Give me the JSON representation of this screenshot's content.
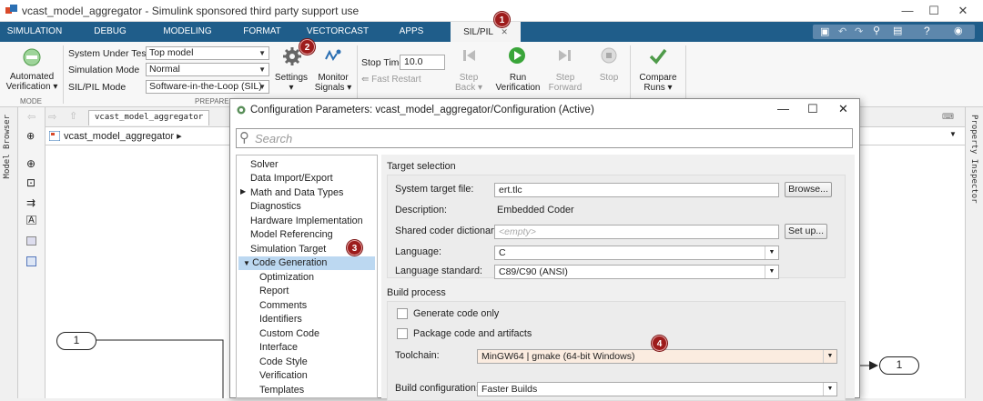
{
  "window": {
    "title": "vcast_model_aggregator - Simulink sponsored third party support use"
  },
  "tabs": [
    "SIMULATION",
    "DEBUG",
    "MODELING",
    "FORMAT",
    "VECTORCAST",
    "APPS",
    "SIL/PIL"
  ],
  "ribbon": {
    "auto_verif": "Automated\nVerification ▾",
    "system_under_test_label": "System Under Test",
    "system_under_test_value": "Top model",
    "sim_mode_label": "Simulation Mode",
    "sim_mode_value": "Normal",
    "silpil_mode_label": "SIL/PIL Mode",
    "silpil_mode_value": "Software-in-the-Loop (SIL)",
    "settings": "Settings",
    "monitor": "Monitor",
    "signals": "Signals ▾",
    "stop_time_label": "Stop Time",
    "stop_time_value": "10.0",
    "fast_restart": "Fast Restart",
    "step_back": "Step",
    "step_back2": "Back ▾",
    "run": "Run",
    "run2": "Verification",
    "step_fwd": "Step",
    "step_fwd2": "Forward",
    "stop": "Stop",
    "compare": "Compare",
    "compare2": "Runs ▾",
    "sect_mode": "MODE",
    "sect_prepare": "PREPARE"
  },
  "badges": [
    "1",
    "2",
    "3",
    "4"
  ],
  "model_browser": {
    "left_label": "Model Browser",
    "right_label": "Property Inspector"
  },
  "nav": {
    "breadcrumb_tab": "vcast_model_aggregator",
    "address": "vcast_model_aggregator ▸"
  },
  "canvas": {
    "inport": "1",
    "outport": "1"
  },
  "dialog": {
    "title": "Configuration Parameters: vcast_model_aggregator/Configuration (Active)",
    "search_placeholder": "Search",
    "tree": [
      "Solver",
      "Data Import/Export",
      "Math and Data Types",
      "Diagnostics",
      "Hardware Implementation",
      "Model Referencing",
      "Simulation Target",
      "Code Generation",
      "Optimization",
      "Report",
      "Comments",
      "Identifiers",
      "Custom Code",
      "Interface",
      "Code Style",
      "Verification",
      "Templates"
    ],
    "target_section": "Target selection",
    "stf_label": "System target file:",
    "stf_value": "ert.tlc",
    "browse": "Browse...",
    "desc_label": "Description:",
    "desc_value": "Embedded Coder",
    "shared_label": "Shared coder dictionary:",
    "shared_value": "<empty>",
    "setup": "Set up...",
    "lang_label": "Language:",
    "lang_value": "C",
    "langstd_label": "Language standard:",
    "langstd_value": "C89/C90 (ANSI)",
    "build_section": "Build process",
    "gen_only": "Generate code only",
    "package": "Package code and artifacts",
    "toolchain_label": "Toolchain:",
    "toolchain_value": "MinGW64 | gmake (64-bit Windows)",
    "buildcfg_label": "Build configuration:",
    "buildcfg_value": "Faster Builds"
  },
  "colors": {
    "tabstrip": "#1f5d8a",
    "badge": "#9d1c1c",
    "selection": "#bcd8f1",
    "toolchain_bg": "#fbece0"
  }
}
